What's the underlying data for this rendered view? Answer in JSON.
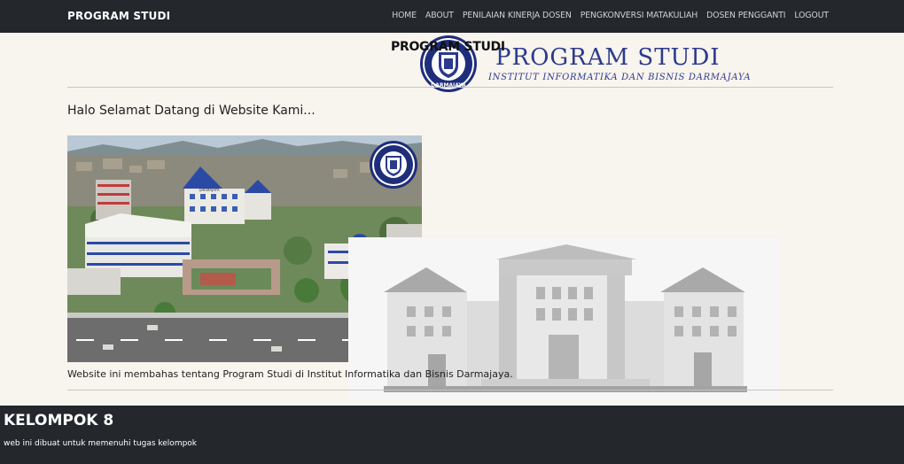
{
  "navbar": {
    "brand": "PROGRAM STUDI",
    "items": [
      {
        "label": "HOME"
      },
      {
        "label": "ABOUT"
      },
      {
        "label": "PENILAIAN KINERJA DOSEN"
      },
      {
        "label": "PENGKONVERSI MATAKULIAH"
      },
      {
        "label": "DOSEN PENGGANTI"
      },
      {
        "label": "LOGOUT"
      }
    ]
  },
  "header": {
    "page_title": "PROGRAM STUDI",
    "banner_title": "PROGRAM STUDI",
    "banner_subtitle": "INSTITUT INFORMATIKA DAN BISNIS DARMAJAYA",
    "seal_name": "DARMAJAYA"
  },
  "main": {
    "welcome": "Halo Selamat Datang di Website Kami...",
    "photo_sign": "DARMAJAYA",
    "description": "Website ini membahas tentang Program Studi di Institut Informatika dan Bisnis Darmajaya."
  },
  "footer": {
    "title": "KELOMPOK 8",
    "text": "web ini dibuat untuk memenuhi tugas kelompok"
  },
  "colors": {
    "navbar_bg": "#24272c",
    "page_bg": "#f8f4ee",
    "brand_blue": "#2b3a8c"
  }
}
